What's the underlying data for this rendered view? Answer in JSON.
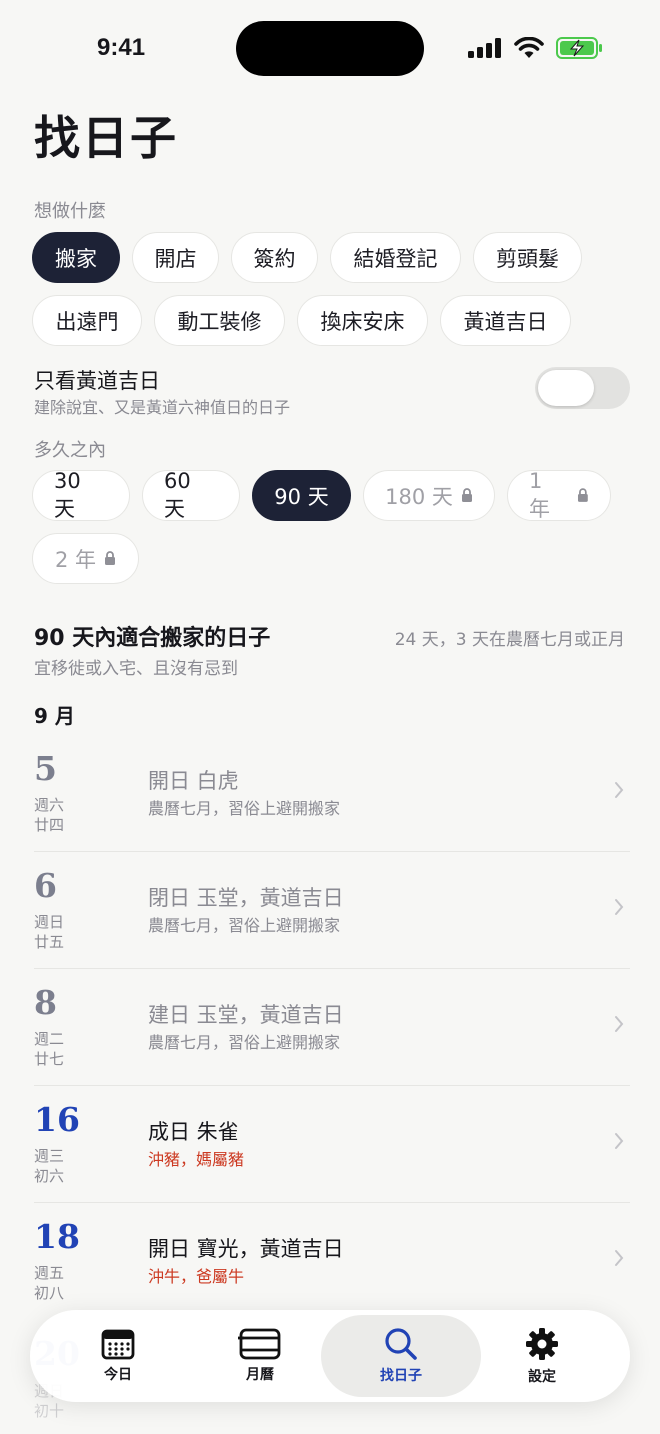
{
  "status": {
    "time": "9:41"
  },
  "title": "找日子",
  "activity": {
    "label": "想做什麼",
    "options": [
      "搬家",
      "開店",
      "簽約",
      "結婚登記",
      "剪頭髮",
      "出遠門",
      "動工裝修",
      "換床安床",
      "黃道吉日"
    ],
    "selected": "搬家"
  },
  "filter": {
    "title": "只看黃道吉日",
    "subtitle": "建除說宜、又是黃道六神值日的日子",
    "enabled": false
  },
  "range": {
    "label": "多久之內",
    "options": [
      {
        "label": "30 天",
        "locked": false
      },
      {
        "label": "60 天",
        "locked": false
      },
      {
        "label": "90 天",
        "locked": false
      },
      {
        "label": "180 天",
        "locked": true
      },
      {
        "label": "1 年",
        "locked": true
      },
      {
        "label": "2 年",
        "locked": true
      }
    ],
    "selected": "90 天"
  },
  "results": {
    "title": "90 天內適合搬家的日子",
    "count": "24 天，3 天在農曆七月或正月",
    "subtitle": "宜移徙或入宅、且沒有忌到",
    "month": "9 月",
    "days": [
      {
        "day": "5",
        "weekday": "週六",
        "lunar": "廿四",
        "main": "開日 白虎",
        "note": "農曆七月，習俗上避開搬家",
        "good": false
      },
      {
        "day": "6",
        "weekday": "週日",
        "lunar": "廿五",
        "main": "閉日 玉堂，黃道吉日",
        "note": "農曆七月，習俗上避開搬家",
        "good": false
      },
      {
        "day": "8",
        "weekday": "週二",
        "lunar": "廿七",
        "main": "建日 玉堂，黃道吉日",
        "note": "農曆七月，習俗上避開搬家",
        "good": false
      },
      {
        "day": "16",
        "weekday": "週三",
        "lunar": "初六",
        "main": "成日 朱雀",
        "note": "沖豬，媽屬豬",
        "good": true
      },
      {
        "day": "18",
        "weekday": "週五",
        "lunar": "初八",
        "main": "開日 寶光，黃道吉日",
        "note": "沖牛，爸屬牛",
        "good": true
      }
    ],
    "partial": {
      "day": "20",
      "weekday": "週日",
      "lunar": "初十"
    }
  },
  "tabs": [
    {
      "label": "今日",
      "icon": "calendar-today-icon"
    },
    {
      "label": "月曆",
      "icon": "calendar-month-icon"
    },
    {
      "label": "找日子",
      "icon": "search-icon",
      "active": true
    },
    {
      "label": "設定",
      "icon": "gear-icon"
    }
  ],
  "colors": {
    "accent": "#2143b5",
    "selected_chip": "#1d2236",
    "warning": "#cc3a22"
  }
}
